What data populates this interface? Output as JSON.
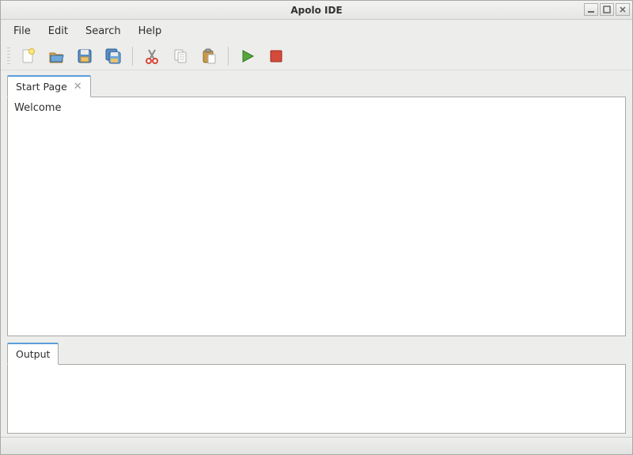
{
  "window": {
    "title": "Apolo IDE"
  },
  "menu": {
    "file": "File",
    "edit": "Edit",
    "search": "Search",
    "help": "Help"
  },
  "toolbar": {
    "new": "new-file-icon",
    "open": "open-folder-icon",
    "save": "save-icon",
    "save_all": "save-all-icon",
    "cut": "cut-icon",
    "copy": "copy-icon",
    "paste": "paste-icon",
    "run": "run-icon",
    "stop": "stop-icon"
  },
  "editor": {
    "tab_label": "Start Page",
    "content": "Welcome"
  },
  "output": {
    "tab_label": "Output",
    "content": ""
  }
}
